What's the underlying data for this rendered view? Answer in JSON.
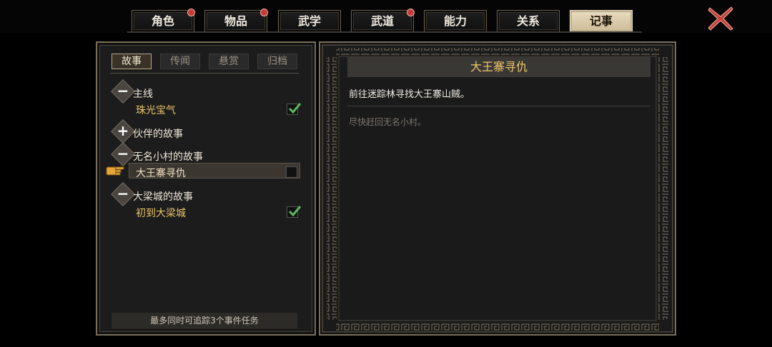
{
  "tabs": [
    {
      "label": "角色",
      "badge": true,
      "active": false
    },
    {
      "label": "物品",
      "badge": true,
      "active": false
    },
    {
      "label": "武学",
      "badge": false,
      "active": false
    },
    {
      "label": "武道",
      "badge": true,
      "active": false
    },
    {
      "label": "能力",
      "badge": false,
      "active": false
    },
    {
      "label": "关系",
      "badge": false,
      "active": false
    },
    {
      "label": "记事",
      "badge": false,
      "active": true
    }
  ],
  "close_icon": "close-x-icon",
  "subtabs": [
    {
      "label": "故事",
      "active": true
    },
    {
      "label": "传闻",
      "active": false
    },
    {
      "label": "悬赏",
      "active": false
    },
    {
      "label": "归档",
      "active": false
    }
  ],
  "categories": [
    {
      "label": "主线",
      "icon": "minus-icon",
      "symbol": "−",
      "quests": [
        {
          "label": "珠光宝气",
          "done": true
        }
      ]
    },
    {
      "label": "伙伴的故事",
      "icon": "plus-icon",
      "symbol": "+",
      "quests": []
    },
    {
      "label": "无名小村的故事",
      "icon": "minus-icon",
      "symbol": "−",
      "quests": [
        {
          "label": "大王寨寻仇",
          "done": false,
          "selected": true
        }
      ]
    },
    {
      "label": "大梁城的故事",
      "icon": "minus-icon",
      "symbol": "−",
      "quests": [
        {
          "label": "初到大梁城",
          "done": true
        }
      ]
    }
  ],
  "footer": "最多同时可追踪3个事件任务",
  "detail": {
    "title": "大王寨寻仇",
    "description": "前往迷踪林寻找大王寨山贼。",
    "hint": "尽快赶回无名小村。"
  },
  "colors": {
    "accent": "#f2c76a",
    "quest": "#e9c46a",
    "check": "#5cb85c",
    "badge": "#c23a3a"
  }
}
